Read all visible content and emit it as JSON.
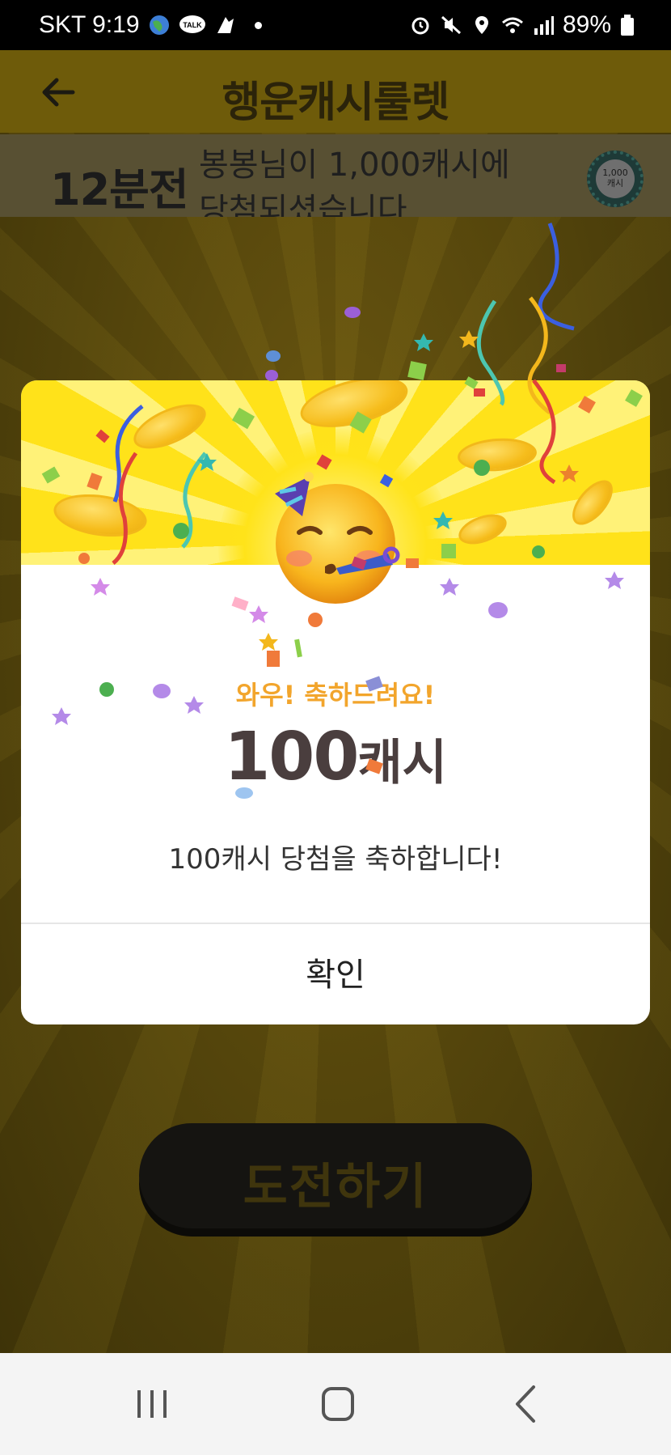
{
  "statusbar": {
    "carrier_time": "SKT 9:19",
    "talk_label": "TALK",
    "battery": "89%"
  },
  "header": {
    "title": "행운캐시룰렛"
  },
  "ticker": {
    "time": "12분전",
    "message": "봉봉님이 1,000캐시에 당첨되셨습니다",
    "badge_line1": "1,000",
    "badge_line2": "캐시"
  },
  "modal": {
    "wow": "와우! 축하드려요!",
    "amount_number": "100",
    "amount_unit": "캐시",
    "description": "100캐시 당첨을 축하합니다!",
    "confirm_label": "확인"
  },
  "background": {
    "challenge_label": "도전하기"
  },
  "colors": {
    "accent_yellow": "#ffe21a",
    "wow_orange": "#f2a52c",
    "amount_brown": "#4a3e3e"
  },
  "icons": {
    "back": "arrow-left-icon",
    "emoji": "party-face-icon",
    "nav_recent": "recent-apps-icon",
    "nav_home": "home-icon",
    "nav_back": "back-icon"
  }
}
